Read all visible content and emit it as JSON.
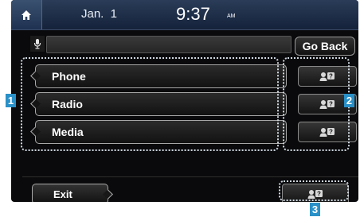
{
  "status_bar": {
    "date": "Jan.  1",
    "time": "9:37",
    "ampm": "AM",
    "home_icon": "home-icon"
  },
  "voice": {
    "mic_icon": "microphone-icon",
    "go_back_label": "Go Back"
  },
  "list": {
    "items": [
      {
        "label": "Phone"
      },
      {
        "label": "Radio"
      },
      {
        "label": "Media"
      }
    ]
  },
  "help_buttons": {
    "icon": "voice-help-icon",
    "count": 3
  },
  "footer": {
    "exit_label": "Exit"
  },
  "callouts": {
    "one": "1",
    "two": "2",
    "three": "3"
  },
  "colors": {
    "callout": "#2a90c8",
    "screen_bg": "#0a0a0c",
    "statusbar": "#1f3150"
  }
}
